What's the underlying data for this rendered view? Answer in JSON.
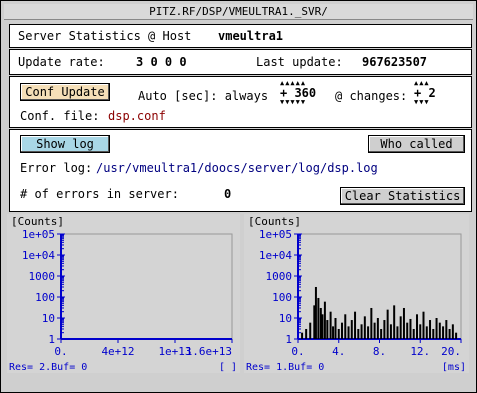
{
  "window": {
    "title": "PITZ.RF/DSP/VMEULTRA1._SVR/"
  },
  "header": {
    "label": "Server Statistics @ Host",
    "host": "vmeultra1"
  },
  "update": {
    "rate_label": "Update rate:",
    "rate_values": "3  0  0  0",
    "last_label": "Last update:",
    "last_value": "967623507"
  },
  "config": {
    "conf_update_label": "Conf Update",
    "auto_label": "Auto [sec]: always",
    "auto_value": "+ 360",
    "changes_label": "@ changes:",
    "changes_value": "+ 2",
    "file_label": "Conf. file:",
    "file_value": "dsp.conf"
  },
  "log": {
    "show_log_label": "Show log",
    "who_called_label": "Who called",
    "error_log_label": "Error log:",
    "error_log_path": "/usr/vmeultra1/doocs/server/log/dsp.log",
    "errors_label": "# of errors in server:",
    "errors_value": "0",
    "clear_label": "Clear Statistics"
  },
  "plots": [
    {
      "title": "[Counts]",
      "y_ticks": [
        "1e+05",
        "1e+04",
        "1000",
        "100",
        "10",
        "1"
      ],
      "x_ticks": [
        "0.",
        "4e+12",
        "1e+13",
        "1.6e+13"
      ],
      "footer_left": "Res= 2.Buf= 0",
      "footer_right": "[ ]"
    },
    {
      "title": "[Counts]",
      "y_ticks": [
        "1e+05",
        "1e+04",
        "1000",
        "100",
        "10",
        "1"
      ],
      "x_ticks": [
        "0.",
        "4.",
        "8.",
        "12.",
        "20."
      ],
      "footer_left": "Res= 1.Buf= 0",
      "footer_right": "[ms]"
    }
  ],
  "colors": {
    "conf_button": "#f5dfb8",
    "show_log_button": "#a9d7e6",
    "who_called_button": "#cfcfcf",
    "link_red": "#8b0000",
    "path_blue": "#000080",
    "plot_axis": "#0000cc",
    "plot_bg": "#d4d4d4"
  },
  "chart_data": [
    {
      "type": "line",
      "title": "",
      "xlabel": "",
      "ylabel": "[Counts]",
      "y_scale": "log",
      "ylim": [
        1,
        100000
      ],
      "xlim": [
        0,
        16000000000000
      ],
      "series": [
        {
          "values": []
        }
      ]
    },
    {
      "type": "line",
      "title": "",
      "xlabel": "",
      "ylabel": "[Counts]",
      "y_scale": "log",
      "ylim": [
        1,
        100000
      ],
      "xlim": [
        0,
        20
      ],
      "series": [
        {
          "x": [
            0.5,
            1,
            1.5,
            2,
            2.2,
            2.5,
            2.8,
            3,
            3.3,
            3.6,
            4,
            4.3,
            4.6,
            5,
            5.4,
            5.8,
            6.2,
            6.6,
            7,
            7.4,
            7.8,
            8.2,
            8.6,
            9,
            9.4,
            9.8,
            10.2,
            10.6,
            11,
            11.4,
            11.8,
            12.2,
            12.6,
            13,
            13.4,
            13.8,
            14.2,
            14.6,
            15,
            15.4,
            15.8,
            16.2,
            16.6,
            17,
            17.4,
            17.8,
            18.2,
            18.6,
            19,
            19.4,
            19.8
          ],
          "values": [
            2,
            3,
            6,
            40,
            300,
            90,
            30,
            15,
            60,
            8,
            20,
            4,
            10,
            3,
            6,
            15,
            4,
            8,
            20,
            3,
            5,
            12,
            4,
            30,
            6,
            10,
            3,
            8,
            25,
            5,
            40,
            4,
            12,
            30,
            6,
            9,
            3,
            15,
            5,
            20,
            4,
            8,
            3,
            10,
            6,
            4,
            8,
            3,
            5,
            2,
            1
          ]
        }
      ]
    }
  ]
}
